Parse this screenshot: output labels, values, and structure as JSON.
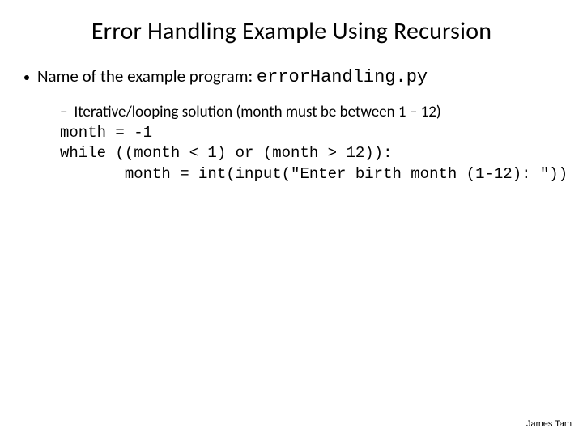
{
  "title": "Error Handling Example Using Recursion",
  "bullet": {
    "prefix": "Name of the example program: ",
    "program_name": "errorHandling.py"
  },
  "sub": {
    "intro": "Iterative/looping solution (month must be between 1 – 12)",
    "code_line1": "month = -1",
    "code_line2": "while ((month < 1) or (month > 12)):",
    "code_line3": "       month = int(input(\"Enter birth month (1-12): \"))"
  },
  "footer": "James Tam"
}
